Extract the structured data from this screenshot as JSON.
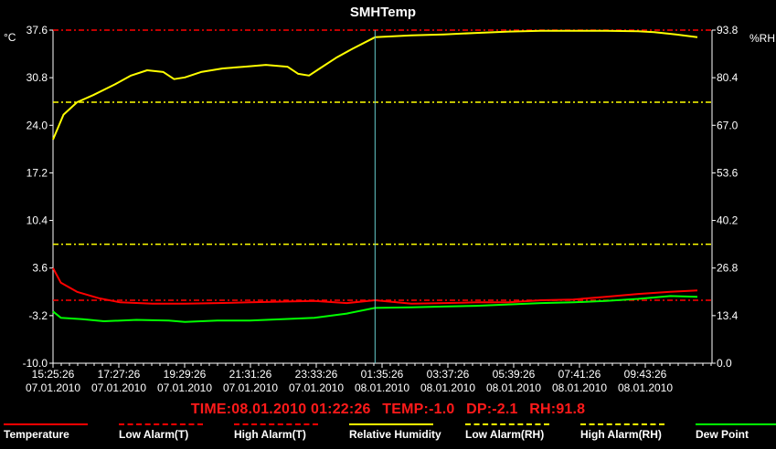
{
  "title": "SMHTemp",
  "status": {
    "time": "TIME:08.01.2010 01:22:26",
    "temp": "TEMP:-1.0",
    "dp": "DP:-2.1",
    "rh": "RH:91.8"
  },
  "colors": {
    "temperature": "#ff0000",
    "humidity": "#ffff00",
    "dewpoint": "#00ff00",
    "cursor": "#66cccc",
    "grid": "#ffffff"
  },
  "legend": [
    {
      "label": "Temperature",
      "color": "#ff0000",
      "style": "solid"
    },
    {
      "label": "Low Alarm(T)",
      "color": "#ff0000",
      "style": "dashdot"
    },
    {
      "label": "High Alarm(T)",
      "color": "#ff0000",
      "style": "dashdot"
    },
    {
      "label": "Relative Humidity",
      "color": "#ffff00",
      "style": "solid"
    },
    {
      "label": "Low Alarm(RH)",
      "color": "#ffff00",
      "style": "dashdot"
    },
    {
      "label": "High Alarm(RH)",
      "color": "#ffff00",
      "style": "dashdot"
    },
    {
      "label": "Dew Point",
      "color": "#00ff00",
      "style": "solid"
    }
  ],
  "chart_data": {
    "type": "line",
    "title": "SMHTemp",
    "ylabel_left": "°C",
    "ylabel_right": "%RH",
    "yticks_left": [
      "37.6",
      "30.8",
      "24.0",
      "17.2",
      "10.4",
      "3.6",
      "-3.2",
      "-10.0"
    ],
    "yticks_right": [
      "93.8",
      "80.4",
      "67.0",
      "53.6",
      "40.2",
      "26.8",
      "13.4",
      "0.0"
    ],
    "ylim_left": [
      -10.0,
      37.6
    ],
    "ylim_right": [
      0.0,
      93.8
    ],
    "xticks": [
      {
        "time": "15:25:26",
        "date": "07.01.2010"
      },
      {
        "time": "17:27:26",
        "date": "07.01.2010"
      },
      {
        "time": "19:29:26",
        "date": "07.01.2010"
      },
      {
        "time": "21:31:26",
        "date": "07.01.2010"
      },
      {
        "time": "23:33:26",
        "date": "07.01.2010"
      },
      {
        "time": "01:35:26",
        "date": "08.01.2010"
      },
      {
        "time": "03:37:26",
        "date": "08.01.2010"
      },
      {
        "time": "05:39:26",
        "date": "08.01.2010"
      },
      {
        "time": "07:41:26",
        "date": "08.01.2010"
      },
      {
        "time": "09:43:26",
        "date": "08.01.2010"
      }
    ],
    "x_end": "08.01.2010 11:25:26",
    "cursor_time": "08.01.2010 01:22:26",
    "alarms": {
      "temp_low": -1.0,
      "temp_high": 37.6,
      "rh_low": 33.5,
      "rh_high": 73.5
    },
    "series": [
      {
        "name": "Temperature",
        "axis": "left",
        "color": "#ff0000",
        "points": [
          [
            "07.01.2010 15:25:26",
            3.6
          ],
          [
            "07.01.2010 15:40:00",
            1.5
          ],
          [
            "07.01.2010 16:10:00",
            0.2
          ],
          [
            "07.01.2010 16:50:00",
            -0.7
          ],
          [
            "07.01.2010 17:30:00",
            -1.3
          ],
          [
            "07.01.2010 18:30:00",
            -1.5
          ],
          [
            "07.01.2010 19:30:00",
            -1.5
          ],
          [
            "07.01.2010 20:30:00",
            -1.4
          ],
          [
            "07.01.2010 21:30:00",
            -1.3
          ],
          [
            "07.01.2010 22:30:00",
            -1.2
          ],
          [
            "07.01.2010 23:30:00",
            -1.1
          ],
          [
            "08.01.2010 00:30:00",
            -1.4
          ],
          [
            "08.01.2010 01:22:26",
            -1.0
          ],
          [
            "08.01.2010 02:30:00",
            -1.5
          ],
          [
            "08.01.2010 03:30:00",
            -1.4
          ],
          [
            "08.01.2010 04:30:00",
            -1.3
          ],
          [
            "08.01.2010 05:30:00",
            -1.3
          ],
          [
            "08.01.2010 06:30:00",
            -1.0
          ],
          [
            "08.01.2010 07:30:00",
            -0.9
          ],
          [
            "08.01.2010 08:30:00",
            -0.5
          ],
          [
            "08.01.2010 09:30:00",
            -0.1
          ],
          [
            "08.01.2010 10:30:00",
            0.2
          ],
          [
            "08.01.2010 11:20:00",
            0.4
          ]
        ]
      },
      {
        "name": "Relative Humidity",
        "axis": "right",
        "color": "#ffff00",
        "points": [
          [
            "07.01.2010 15:25:26",
            63.0
          ],
          [
            "07.01.2010 15:45:00",
            70.0
          ],
          [
            "07.01.2010 16:10:00",
            73.5
          ],
          [
            "07.01.2010 16:40:00",
            75.5
          ],
          [
            "07.01.2010 17:20:00",
            78.5
          ],
          [
            "07.01.2010 17:50:00",
            81.0
          ],
          [
            "07.01.2010 18:20:00",
            82.5
          ],
          [
            "07.01.2010 18:50:00",
            82.0
          ],
          [
            "07.01.2010 19:10:00",
            80.0
          ],
          [
            "07.01.2010 19:30:00",
            80.5
          ],
          [
            "07.01.2010 20:00:00",
            82.0
          ],
          [
            "07.01.2010 20:40:00",
            83.0
          ],
          [
            "07.01.2010 21:20:00",
            83.5
          ],
          [
            "07.01.2010 22:00:00",
            84.0
          ],
          [
            "07.01.2010 22:40:00",
            83.5
          ],
          [
            "07.01.2010 23:00:00",
            81.5
          ],
          [
            "07.01.2010 23:20:00",
            81.0
          ],
          [
            "07.01.2010 23:40:00",
            83.0
          ],
          [
            "08.01.2010 00:10:00",
            86.0
          ],
          [
            "08.01.2010 00:40:00",
            88.5
          ],
          [
            "08.01.2010 01:22:26",
            91.8
          ],
          [
            "08.01.2010 02:30:00",
            92.3
          ],
          [
            "08.01.2010 03:30:00",
            92.6
          ],
          [
            "08.01.2010 04:30:00",
            93.0
          ],
          [
            "08.01.2010 05:30:00",
            93.4
          ],
          [
            "08.01.2010 06:30:00",
            93.6
          ],
          [
            "08.01.2010 07:30:00",
            93.6
          ],
          [
            "08.01.2010 08:30:00",
            93.6
          ],
          [
            "08.01.2010 09:30:00",
            93.5
          ],
          [
            "08.01.2010 10:00:00",
            93.2
          ],
          [
            "08.01.2010 10:40:00",
            92.6
          ],
          [
            "08.01.2010 11:20:00",
            91.8
          ]
        ]
      },
      {
        "name": "Dew Point",
        "axis": "left",
        "color": "#00ff00",
        "points": [
          [
            "07.01.2010 15:25:26",
            -2.6
          ],
          [
            "07.01.2010 15:40:00",
            -3.5
          ],
          [
            "07.01.2010 16:20:00",
            -3.7
          ],
          [
            "07.01.2010 17:00:00",
            -4.0
          ],
          [
            "07.01.2010 18:00:00",
            -3.8
          ],
          [
            "07.01.2010 19:00:00",
            -3.9
          ],
          [
            "07.01.2010 19:30:00",
            -4.1
          ],
          [
            "07.01.2010 20:30:00",
            -3.9
          ],
          [
            "07.01.2010 21:30:00",
            -3.9
          ],
          [
            "07.01.2010 22:30:00",
            -3.7
          ],
          [
            "07.01.2010 23:30:00",
            -3.5
          ],
          [
            "08.01.2010 00:30:00",
            -2.9
          ],
          [
            "08.01.2010 01:22:26",
            -2.1
          ],
          [
            "08.01.2010 02:30:00",
            -2.0
          ],
          [
            "08.01.2010 03:30:00",
            -1.9
          ],
          [
            "08.01.2010 04:30:00",
            -1.8
          ],
          [
            "08.01.2010 05:30:00",
            -1.6
          ],
          [
            "08.01.2010 06:30:00",
            -1.4
          ],
          [
            "08.01.2010 07:30:00",
            -1.3
          ],
          [
            "08.01.2010 08:30:00",
            -1.1
          ],
          [
            "08.01.2010 09:30:00",
            -0.8
          ],
          [
            "08.01.2010 10:30:00",
            -0.4
          ],
          [
            "08.01.2010 11:20:00",
            -0.5
          ]
        ]
      }
    ]
  }
}
